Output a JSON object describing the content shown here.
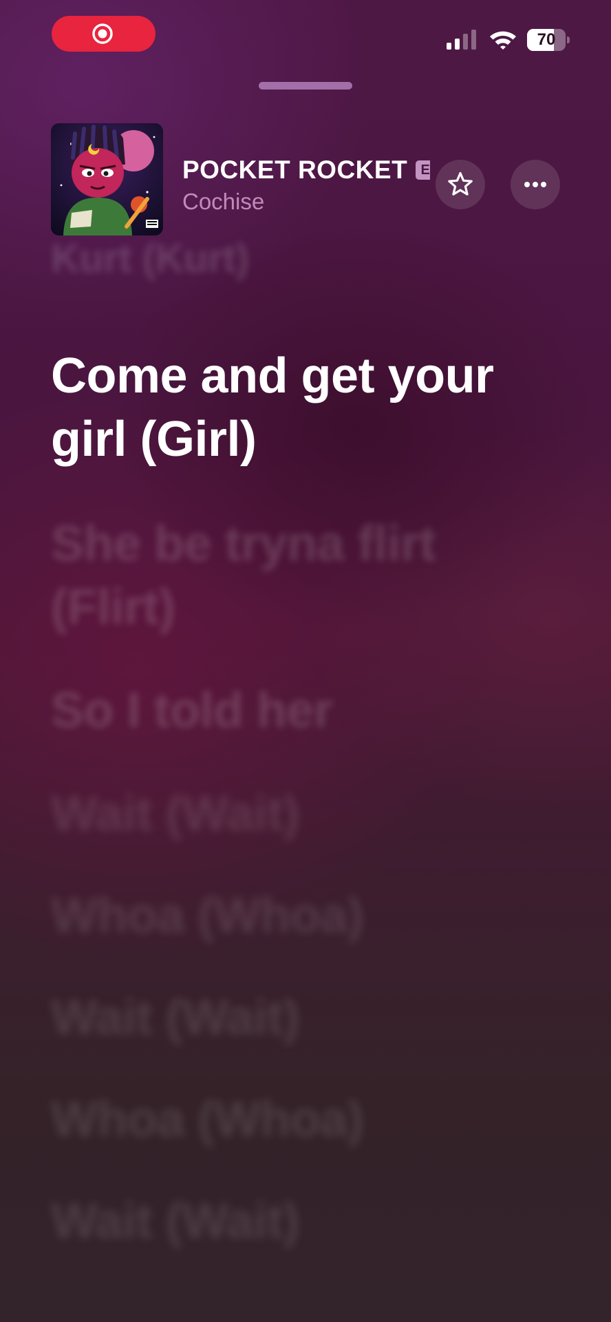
{
  "status_bar": {
    "battery_level": "70",
    "battery_fraction": 0.7,
    "recording_indicator": "screen-record-icon",
    "signal_icon": "cellular-signal-icon",
    "wifi_icon": "wifi-icon"
  },
  "now_playing": {
    "title": "POCKET ROCKET",
    "explicit_badge": "E",
    "artist": "Cochise",
    "favorite_icon": "star-icon",
    "more_icon": "ellipsis-icon"
  },
  "lyrics": {
    "previous": "Kurt (Kurt)",
    "current": "Come and get your girl (Girl)",
    "upcoming": [
      "She be tryna flirt (Flirt)",
      "So I told her",
      "Wait (Wait)",
      "Whoa (Whoa)",
      "Wait (Wait)",
      "Whoa (Whoa)",
      "Wait (Wait)"
    ]
  },
  "colors": {
    "record_pill": "#e8243f",
    "background_top": "#4e1845",
    "background_bottom": "#33232a",
    "artist_text": "#d2a0cd"
  }
}
